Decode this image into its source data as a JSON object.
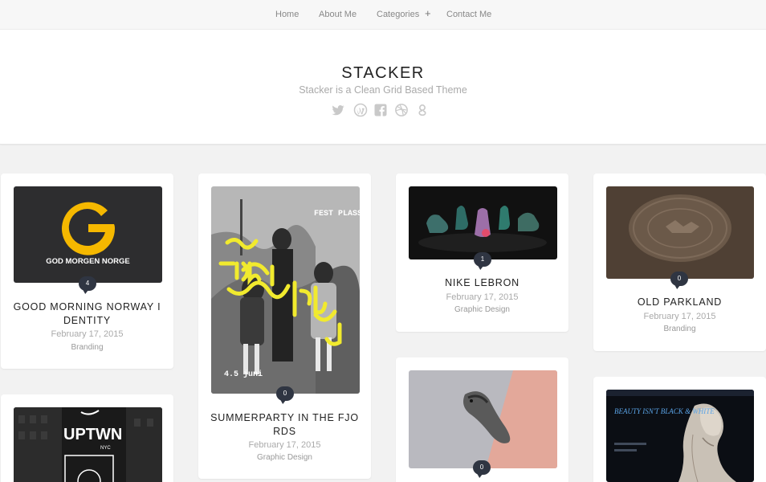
{
  "nav": {
    "items": [
      "Home",
      "About Me",
      "Categories",
      "Contact Me"
    ],
    "categories_expand": "+"
  },
  "header": {
    "title": "STACKER",
    "tagline": "Stacker is a Clean Grid Based Theme",
    "social_icons": [
      "twitter-icon",
      "wordpress-icon",
      "facebook-icon",
      "dribbble-icon",
      "google-plus-icon"
    ]
  },
  "posts": [
    {
      "title": "GOOD MORNING NORWAY I DENTITY",
      "date": "February 17, 2015",
      "category": "Branding",
      "comments": "4",
      "thumb_text": "GOD MORGEN NORGE",
      "logo_letter": "G"
    },
    {
      "title": "SUMMERPARTY IN THE FJO RDS",
      "date": "February 17, 2015",
      "category": "Graphic Design",
      "comments": "0",
      "thumb_text": "FEST PLASSEN I KORDIEI",
      "thumb_date": "4.5 juni"
    },
    {
      "title": "NIKE LEBRON",
      "date": "February 17, 2015",
      "category": "Graphic Design",
      "comments": "1"
    },
    {
      "title": "OLD PARKLAND",
      "date": "February 17, 2015",
      "category": "Branding",
      "comments": "0"
    },
    {
      "title": "",
      "date": "",
      "category": "",
      "comments": "0"
    },
    {
      "title": "",
      "date": "",
      "category": "",
      "comments": "",
      "thumb_text": "UPTWN",
      "thumb_sub": "NYC"
    },
    {
      "title": "",
      "date": "",
      "category": "",
      "comments": "",
      "thumb_text": "BEAUTY ISN'T BLACK & WHITE"
    }
  ],
  "colors": {
    "bubble": "#2f3542",
    "page_bg": "#f2f2f2",
    "logo_yellow": "#f5b800",
    "poster_yellow": "#f1ea2e"
  }
}
